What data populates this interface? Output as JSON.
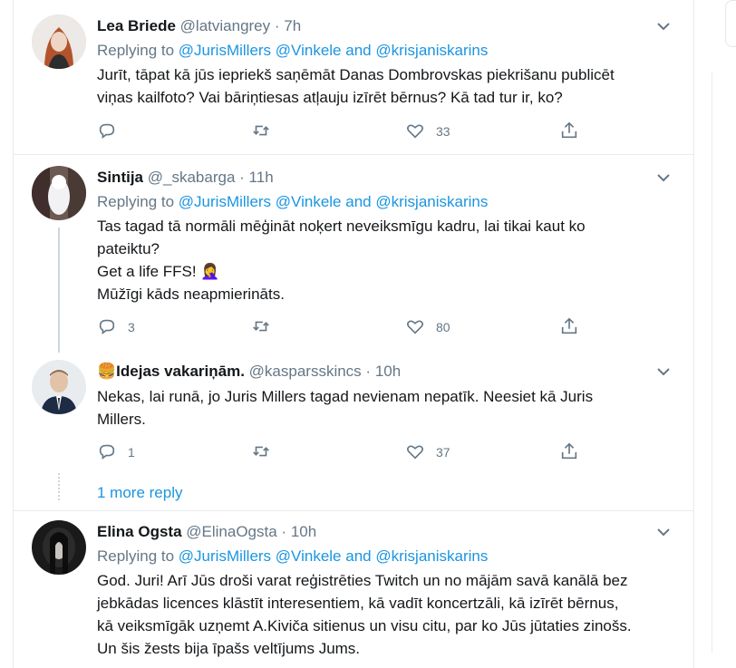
{
  "tweets": [
    {
      "name": "Lea Briede",
      "handle": "@latviangrey",
      "separator": "·",
      "time": "7h",
      "replying_prefix": "Replying to",
      "mention1": "@JurisMillers",
      "mention2": "@Vinkele",
      "and": "and",
      "mention3": "@krisjaniskarins",
      "lines": [
        "Jurīt, tāpat kā jūs iepriekš saņēmāt Danas Dombrovskas piekrišanu publicēt",
        "viņas kailfoto? Vai bāriņtiesas atļauju izīrēt bērnus? Kā tad tur ir, ko?"
      ],
      "reply_count": "",
      "retweet_count": "",
      "like_count": "33"
    },
    {
      "name": "Sintija",
      "handle": "@_skabarga",
      "separator": "·",
      "time": "11h",
      "replying_prefix": "Replying to",
      "mention1": "@JurisMillers",
      "mention2": "@Vinkele",
      "and": "and",
      "mention3": "@krisjaniskarins",
      "lines": [
        "Tas tagad tā normāli mēģināt noķert neveiksmīgu kadru, lai tikai kaut ko",
        "pateiktu?",
        "Get a life FFS!",
        "Mūžīgi kāds neapmierināts."
      ],
      "emoji": "🤦‍♀️",
      "reply_count": "3",
      "retweet_count": "",
      "like_count": "80"
    },
    {
      "name": "Idejas vakariņām.",
      "name_emoji": "🍔",
      "handle": "@kasparsskincs",
      "separator": "·",
      "time": "10h",
      "lines": [
        "Nekas, lai runā, jo Juris Millers tagad nevienam nepatīk. Neesiet kā Juris",
        "Millers."
      ],
      "reply_count": "1",
      "retweet_count": "",
      "like_count": "37"
    },
    {
      "name": "Elina Ogsta",
      "handle": "@ElinaOgsta",
      "separator": "·",
      "time": "10h",
      "replying_prefix": "Replying to",
      "mention1": "@JurisMillers",
      "mention2": "@Vinkele",
      "and": "and",
      "mention3": "@krisjaniskarins",
      "lines": [
        "God. Juri! Arī Jūs droši varat reģistrēties Twitch un no mājām savā kanālā bez",
        "jebkādas licences klāstīt interesentiem, kā vadīt koncertzāli, kā izīrēt bērnus,",
        "kā veiksmīgāk uzņemt A.Kiviča sitienus un visu citu, par ko Jūs jūtaties zinošs.",
        "Un šis žests bija īpašs veltījums Jums."
      ]
    }
  ],
  "more_reply": "1 more reply",
  "icons": {
    "reply": "reply-icon",
    "retweet": "retweet-icon",
    "like": "heart-icon",
    "share": "share-icon",
    "caret": "chevron-down-icon"
  },
  "colors": {
    "link": "#1b95e0",
    "secondary": "#657786",
    "text": "#14171a",
    "border": "#e6ecf0"
  }
}
